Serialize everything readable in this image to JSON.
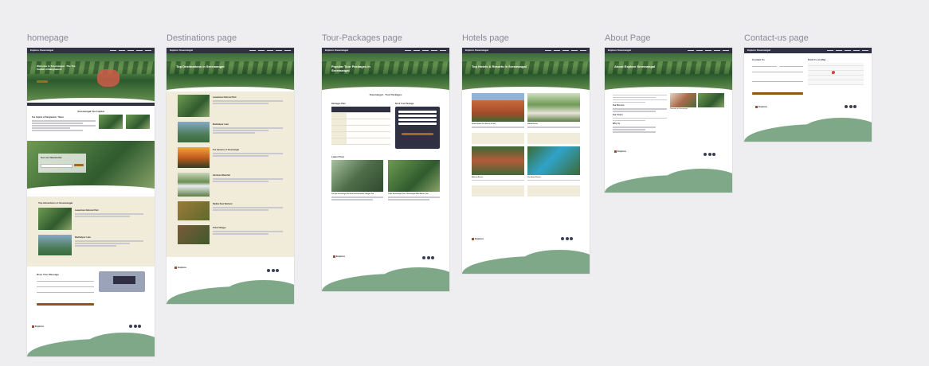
{
  "frames": [
    {
      "title": "homepage"
    },
    {
      "title": "Destinations page"
    },
    {
      "title": "Tour-Packages page"
    },
    {
      "title": "Hotels page"
    },
    {
      "title": "About Page"
    },
    {
      "title": "Contact-us page"
    }
  ],
  "brand": {
    "logo": "Explore Sreemangal",
    "footer_logo": "Explore"
  },
  "homepage": {
    "hero_title": "Welcome to Sreemangal - The Tea Capital of Bangladesh",
    "capital_heading": "Sreemangal Tea Capital",
    "intro_heading": "Tea Capital of Bangladesh, Tibeta",
    "newsletter_heading": "Get our Newsletter",
    "attractions_heading": "Top Attractions in Sreemangal",
    "attractions": [
      "Lawachara National Park",
      "Madhabpur Lake"
    ],
    "message_heading": "Drop Your Message"
  },
  "destinations": {
    "hero_title": "Top Destinations in Sreemangal",
    "items": [
      "Lawachara National Park",
      "Madhabpur Lake",
      "Tea Gardens of Sreemangal",
      "Hamham Waterfall",
      "Baikka Beel Wetland",
      "Tribal Villages"
    ]
  },
  "tours": {
    "hero_title": "Popular Tour Packages in Sreemangal",
    "section_heading": "Sreemangal - Tour Packages",
    "packages_heading": "Packages Plan",
    "form_heading": "Book Your Package",
    "latest_heading": "Latest Tour",
    "latest_items": [
      "Tea Sip Sreemangal: An Aroma of Aromatic Villages Tea",
      "Trails Sreemangal Tour: Sreemangal Wild Nature Tour"
    ]
  },
  "hotels": {
    "hero_title": "Top Hotels & Resorts in Sreemangal",
    "items": [
      "Grand Sultan Tea Resort & Golf",
      "Nabila Resort",
      "Balisira Resort",
      "Tea Haven Resort"
    ]
  },
  "about": {
    "hero_title": "About Explore Sreemangal",
    "caption": "Welcome to Sreemangal",
    "headings": [
      "Our Mission",
      "Our Vision",
      "Why Us"
    ]
  },
  "contact": {
    "contact_heading": "Contact Us",
    "map_heading": "Find Us on Map"
  }
}
